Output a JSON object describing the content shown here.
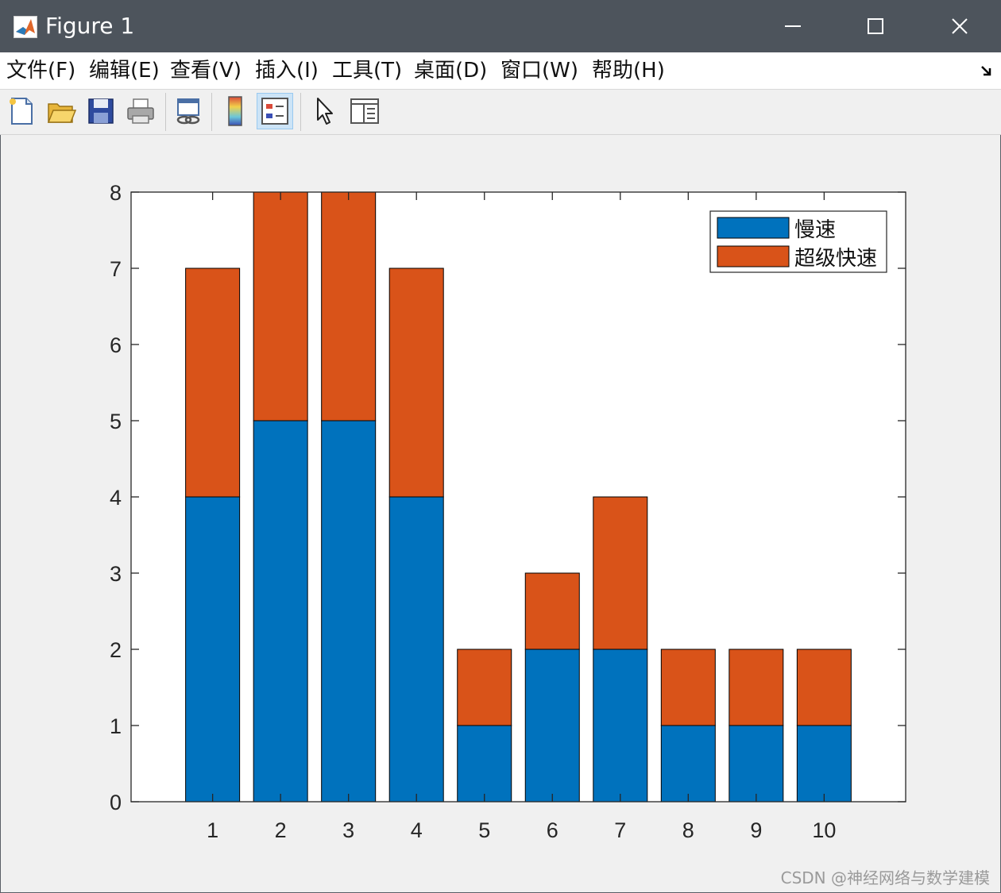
{
  "window": {
    "title": "Figure 1",
    "icons": {
      "app": "matlab-icon",
      "minimize": "minimize-icon",
      "maximize": "maximize-icon",
      "close": "close-icon"
    }
  },
  "menu": [
    {
      "label": "文件(F)"
    },
    {
      "label": "编辑(E)"
    },
    {
      "label": "查看(V)"
    },
    {
      "label": "插入(I)"
    },
    {
      "label": "工具(T)"
    },
    {
      "label": "桌面(D)"
    },
    {
      "label": "窗口(W)"
    },
    {
      "label": "帮助(H)"
    }
  ],
  "toolbar": {
    "buttons": [
      "new-figure-icon",
      "open-file-icon",
      "save-icon",
      "print-icon",
      "link-plot-icon",
      "colorbar-icon",
      "legend-icon",
      "pointer-icon",
      "property-editor-icon"
    ],
    "active": "legend-icon"
  },
  "chart_data": {
    "type": "bar",
    "stacked": true,
    "categories": [
      "1",
      "2",
      "3",
      "4",
      "5",
      "6",
      "7",
      "8",
      "9",
      "10"
    ],
    "series": [
      {
        "name": "慢速",
        "values": [
          4,
          5,
          5,
          4,
          1,
          2,
          2,
          1,
          1,
          1
        ],
        "color": "#0072BD"
      },
      {
        "name": "超级快速",
        "values": [
          3,
          3,
          3,
          3,
          1,
          1,
          2,
          1,
          1,
          1
        ],
        "color": "#D95319"
      }
    ],
    "ylim": [
      0,
      8
    ],
    "yticks": [
      0,
      1,
      2,
      3,
      4,
      5,
      6,
      7,
      8
    ],
    "xlim": [
      -0.2,
      11.2
    ],
    "title": "",
    "xlabel": "",
    "ylabel": "",
    "grid": false,
    "legend_position": "top-right"
  },
  "watermark": "CSDN @神经网络与数学建模"
}
